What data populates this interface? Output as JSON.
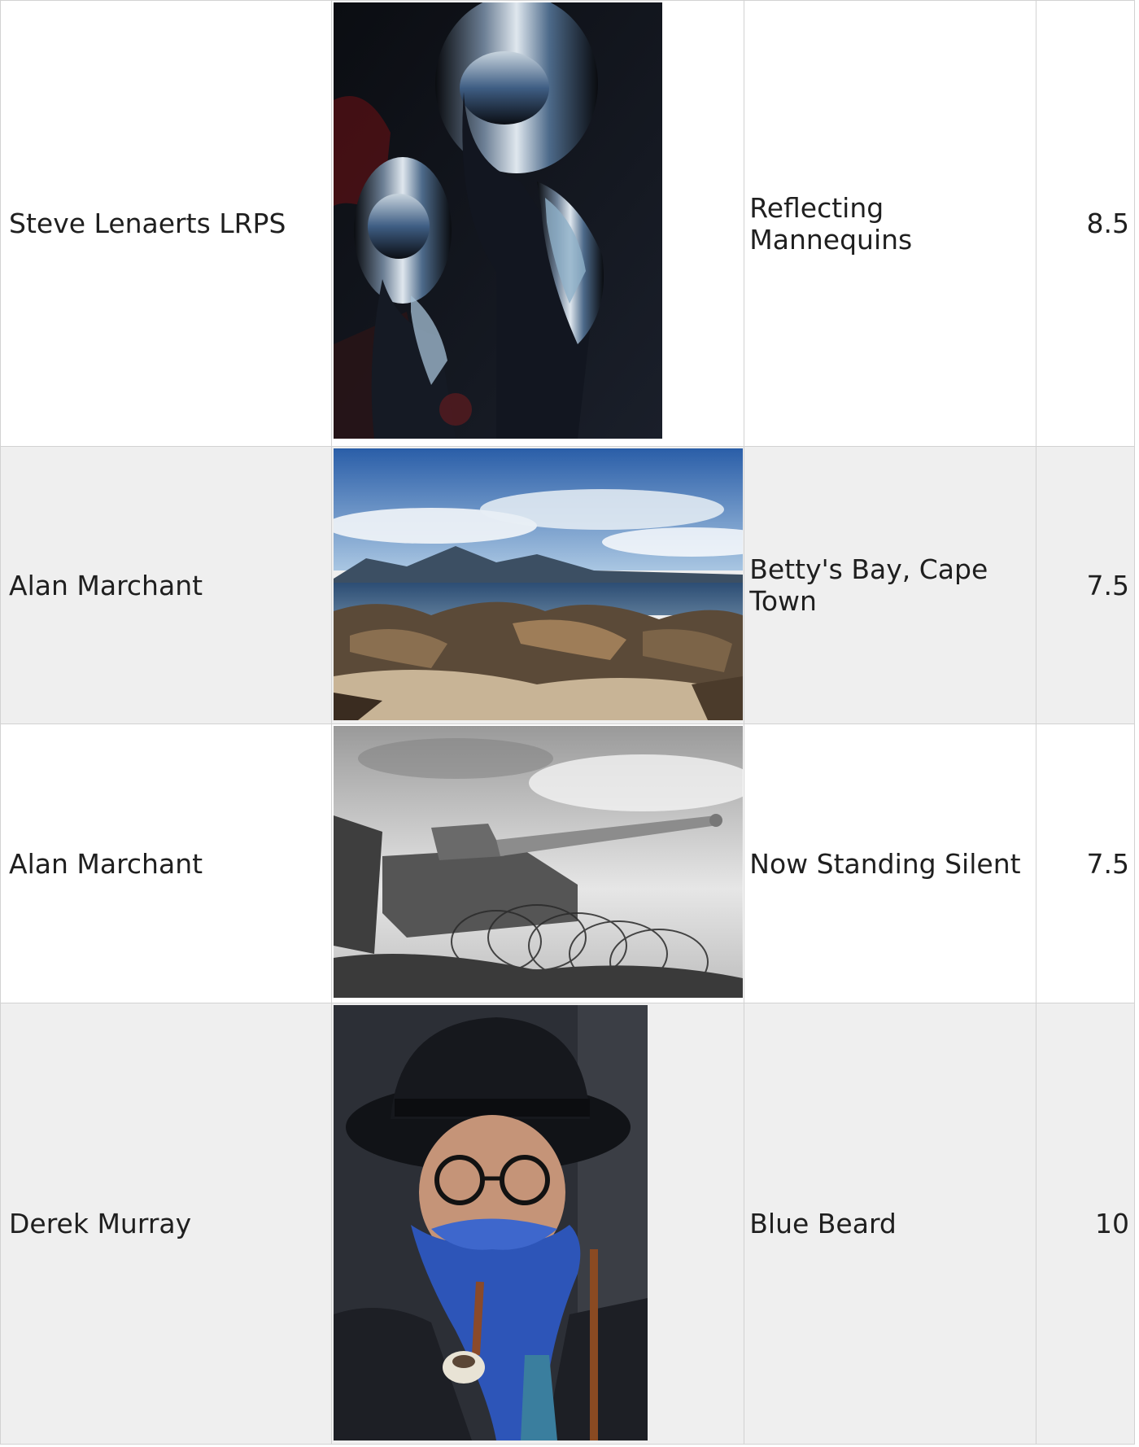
{
  "entries": [
    {
      "author": "Steve Lenaerts LRPS",
      "title": "Reflecting Mannequins",
      "score": "8.5",
      "image_alt": "mannequins-photo"
    },
    {
      "author": "Alan Marchant",
      "title": "Betty's Bay, Cape Town",
      "score": "7.5",
      "image_alt": "coastline-photo"
    },
    {
      "author": "Alan Marchant",
      "title": "Now Standing Silent",
      "score": "7.5",
      "image_alt": "tank-photo"
    },
    {
      "author": "Derek Murray",
      "title": "Blue Beard",
      "score": "10",
      "image_alt": "portrait-photo"
    }
  ],
  "colors": {
    "border": "#d2d2d2",
    "alt_row": "#efefef",
    "text": "#1f1f1f"
  }
}
